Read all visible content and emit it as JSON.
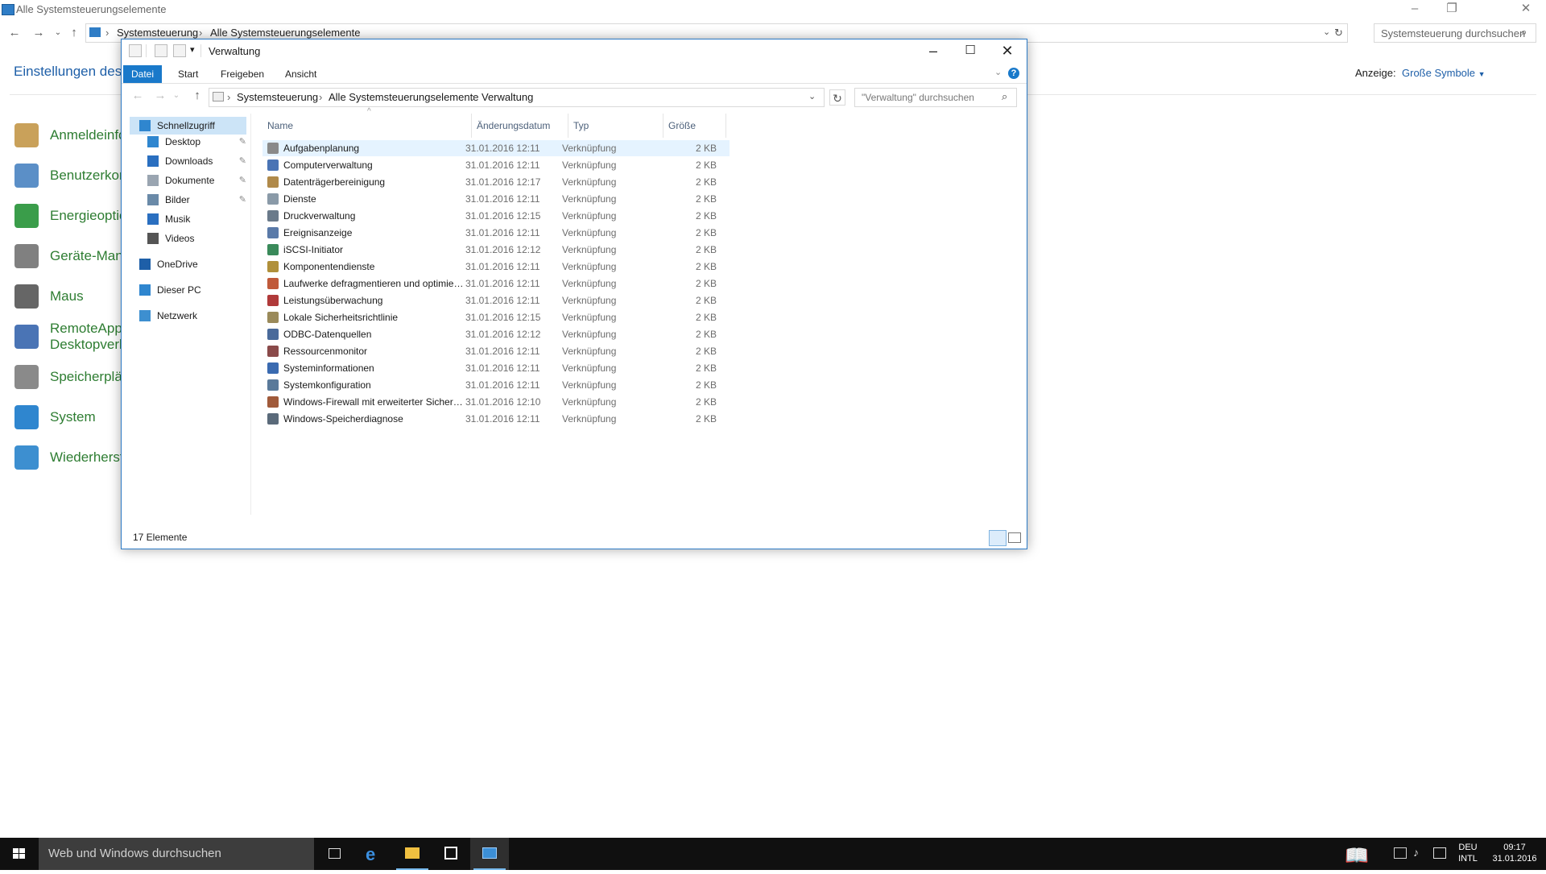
{
  "bg_window": {
    "title": "Alle Systemsteuerungselemente",
    "breadcrumb": [
      "Systemsteuerung",
      "Alle Systemsteuerungselemente"
    ],
    "search_placeholder": "Systemsteuerung durchsuchen",
    "header_title": "Einstellungen des C",
    "view_label": "Anzeige:",
    "view_value": "Große Symbole",
    "items": [
      {
        "label": "Anmeldeinfo",
        "icon": "credential-icon",
        "color": "#c9a15a"
      },
      {
        "label": "Benutzerkon",
        "icon": "users-icon",
        "color": "#5b8fc7"
      },
      {
        "label": "Energieoptio",
        "icon": "power-icon",
        "color": "#3a9d4a"
      },
      {
        "label": "Geräte-Mana",
        "icon": "device-manager-icon",
        "color": "#808080"
      },
      {
        "label": "Maus",
        "icon": "mouse-icon",
        "color": "#666666"
      },
      {
        "label": "RemoteApp-",
        "label2": "Desktopverb",
        "icon": "remote-desktop-icon",
        "color": "#4a74b5"
      },
      {
        "label": "Speicherplät",
        "icon": "storage-icon",
        "color": "#8a8a8a"
      },
      {
        "label": "System",
        "icon": "system-icon",
        "color": "#2f86cf"
      },
      {
        "label": "Wiederherste",
        "icon": "recovery-icon",
        "color": "#3d8fd0"
      }
    ]
  },
  "explorer": {
    "title": "Verwaltung",
    "ribbon_tabs": [
      "Datei",
      "Start",
      "Freigeben",
      "Ansicht"
    ],
    "breadcrumb": [
      "Systemsteuerung",
      "Alle Systemsteuerungselemente",
      "Verwaltung"
    ],
    "search_placeholder": "\"Verwaltung\" durchsuchen",
    "sidebar": [
      {
        "label": "Schnellzugriff",
        "icon": "star-icon",
        "color": "#2f86cf",
        "indent": 0,
        "pinned": false,
        "active": true
      },
      {
        "label": "Desktop",
        "icon": "desktop-icon",
        "color": "#2f86cf",
        "indent": 1,
        "pinned": true,
        "active": false
      },
      {
        "label": "Downloads",
        "icon": "download-icon",
        "color": "#2a6fc0",
        "indent": 1,
        "pinned": true,
        "active": false
      },
      {
        "label": "Dokumente",
        "icon": "document-icon",
        "color": "#9aa5b1",
        "indent": 1,
        "pinned": true,
        "active": false
      },
      {
        "label": "Bilder",
        "icon": "pictures-icon",
        "color": "#6a8aa8",
        "indent": 1,
        "pinned": true,
        "active": false
      },
      {
        "label": "Musik",
        "icon": "music-icon",
        "color": "#2a6fc0",
        "indent": 1,
        "pinned": false,
        "active": false
      },
      {
        "label": "Videos",
        "icon": "videos-icon",
        "color": "#555555",
        "indent": 1,
        "pinned": false,
        "active": false
      },
      {
        "label": "OneDrive",
        "icon": "onedrive-icon",
        "color": "#1e5fa8",
        "indent": 0,
        "pinned": false,
        "active": false
      },
      {
        "label": "Dieser PC",
        "icon": "pc-icon",
        "color": "#2f86cf",
        "indent": 0,
        "pinned": false,
        "active": false
      },
      {
        "label": "Netzwerk",
        "icon": "network-icon",
        "color": "#3d8fd0",
        "indent": 0,
        "pinned": false,
        "active": false
      }
    ],
    "columns": [
      "Name",
      "Änderungsdatum",
      "Typ",
      "Größe"
    ],
    "files": [
      {
        "name": "Aufgabenplanung",
        "date": "31.01.2016 12:11",
        "type": "Verknüpfung",
        "size": "2 KB",
        "color": "#8a8a8a"
      },
      {
        "name": "Computerverwaltung",
        "date": "31.01.2016 12:11",
        "type": "Verknüpfung",
        "size": "2 KB",
        "color": "#4a74b5"
      },
      {
        "name": "Datenträgerbereinigung",
        "date": "31.01.2016 12:17",
        "type": "Verknüpfung",
        "size": "2 KB",
        "color": "#b08a4a"
      },
      {
        "name": "Dienste",
        "date": "31.01.2016 12:11",
        "type": "Verknüpfung",
        "size": "2 KB",
        "color": "#8a9aa8"
      },
      {
        "name": "Druckverwaltung",
        "date": "31.01.2016 12:15",
        "type": "Verknüpfung",
        "size": "2 KB",
        "color": "#6a7a8a"
      },
      {
        "name": "Ereignisanzeige",
        "date": "31.01.2016 12:11",
        "type": "Verknüpfung",
        "size": "2 KB",
        "color": "#5a7aa8"
      },
      {
        "name": "iSCSI-Initiator",
        "date": "31.01.2016 12:12",
        "type": "Verknüpfung",
        "size": "2 KB",
        "color": "#3a8a5a"
      },
      {
        "name": "Komponentendienste",
        "date": "31.01.2016 12:11",
        "type": "Verknüpfung",
        "size": "2 KB",
        "color": "#b0903a"
      },
      {
        "name": "Laufwerke defragmentieren und optimieren",
        "date": "31.01.2016 12:11",
        "type": "Verknüpfung",
        "size": "2 KB",
        "color": "#c05a3a"
      },
      {
        "name": "Leistungsüberwachung",
        "date": "31.01.2016 12:11",
        "type": "Verknüpfung",
        "size": "2 KB",
        "color": "#b03a3a"
      },
      {
        "name": "Lokale Sicherheitsrichtlinie",
        "date": "31.01.2016 12:15",
        "type": "Verknüpfung",
        "size": "2 KB",
        "color": "#9a8a5a"
      },
      {
        "name": "ODBC-Datenquellen",
        "date": "31.01.2016 12:12",
        "type": "Verknüpfung",
        "size": "2 KB",
        "color": "#4a6a9a"
      },
      {
        "name": "Ressourcenmonitor",
        "date": "31.01.2016 12:11",
        "type": "Verknüpfung",
        "size": "2 KB",
        "color": "#8a4a4a"
      },
      {
        "name": "Systeminformationen",
        "date": "31.01.2016 12:11",
        "type": "Verknüpfung",
        "size": "2 KB",
        "color": "#3a6ab0"
      },
      {
        "name": "Systemkonfiguration",
        "date": "31.01.2016 12:11",
        "type": "Verknüpfung",
        "size": "2 KB",
        "color": "#5a7a9a"
      },
      {
        "name": "Windows-Firewall mit erweiterter Sicherheit",
        "date": "31.01.2016 12:10",
        "type": "Verknüpfung",
        "size": "2 KB",
        "color": "#a05a3a"
      },
      {
        "name": "Windows-Speicherdiagnose",
        "date": "31.01.2016 12:11",
        "type": "Verknüpfung",
        "size": "2 KB",
        "color": "#5a6a7a"
      }
    ],
    "status": "17 Elemente"
  },
  "taskbar": {
    "search_placeholder": "Web und Windows durchsuchen",
    "lang_top": "DEU",
    "lang_bottom": "INTL",
    "time": "09:17",
    "date": "31.01.2016"
  },
  "colors": {
    "accent": "#1979ca",
    "selection": "#cce4f7",
    "taskbar": "#101010",
    "link_green": "#2e7d32"
  }
}
